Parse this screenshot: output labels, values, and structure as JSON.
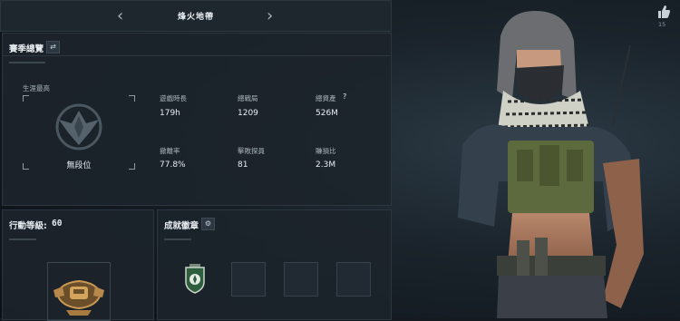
{
  "header": {
    "title": "烽火地帶"
  },
  "season": {
    "title": "賽季總覽",
    "career_best_label": "生涯最高",
    "rank_name": "無段位",
    "stats": [
      {
        "label": "遊戲時長",
        "value": "179h"
      },
      {
        "label": "總戰局",
        "value": "1209"
      },
      {
        "label": "總資產",
        "value": "526M",
        "help": "?"
      },
      {
        "label": "撤離率",
        "value": "77.8%"
      },
      {
        "label": "擊敗探員",
        "value": "81"
      },
      {
        "label": "賺損比",
        "value": "2.3M"
      }
    ]
  },
  "action_level": {
    "label": "行動等級:",
    "value": "60"
  },
  "badges": {
    "title": "成就徽章"
  },
  "like": {
    "count": "15"
  }
}
